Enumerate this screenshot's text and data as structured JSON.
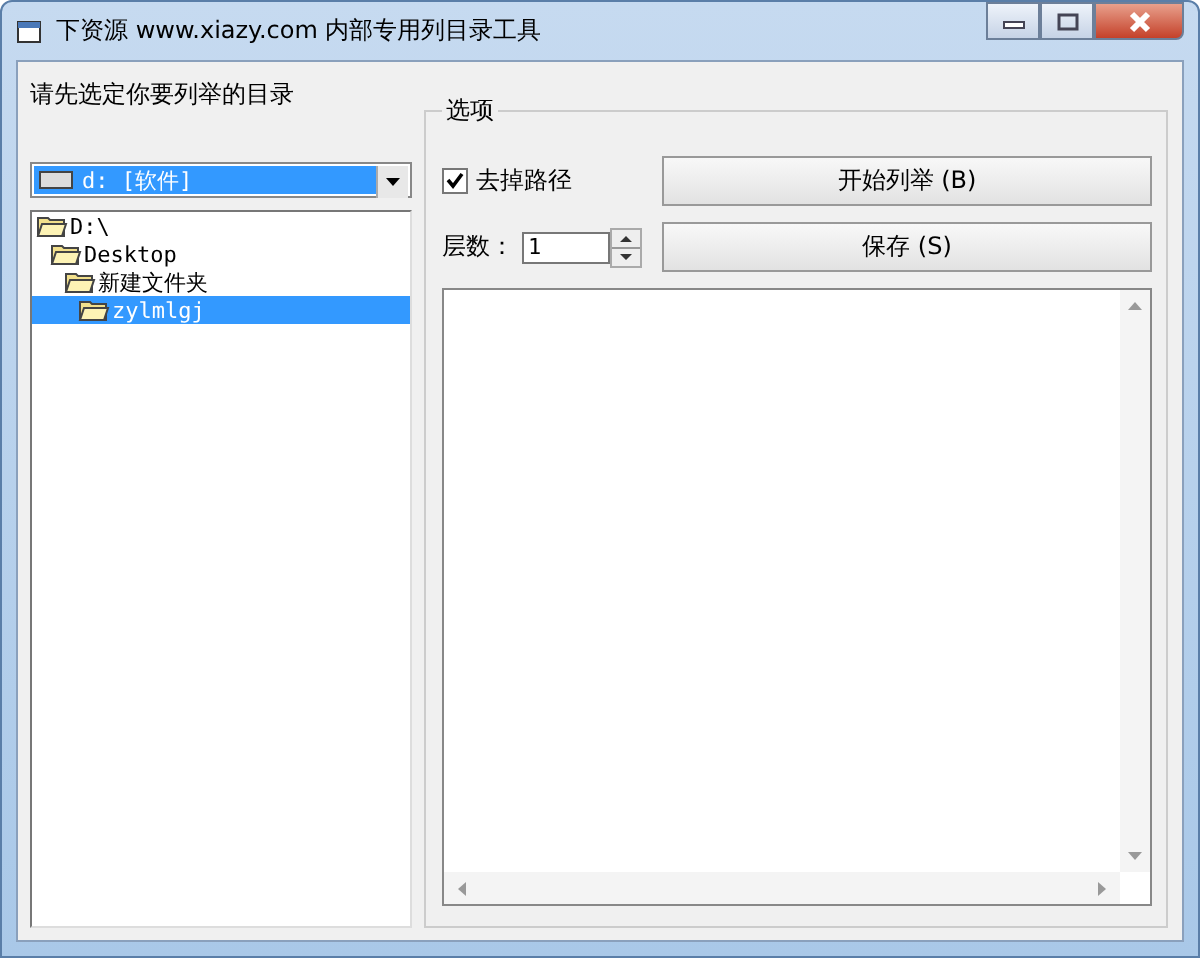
{
  "window": {
    "title": "下资源 www.xiazy.com 内部专用列目录工具"
  },
  "prompt": "请先选定你要列举的目录",
  "drive": {
    "value": "d: [软件]"
  },
  "tree": [
    {
      "label": "D:\\",
      "selected": false,
      "children": [
        {
          "label": "Desktop",
          "selected": false,
          "children": [
            {
              "label": "新建文件夹",
              "selected": false,
              "children": [
                {
                  "label": "zylmlgj",
                  "selected": true
                }
              ]
            }
          ]
        }
      ]
    }
  ],
  "options": {
    "title": "选项",
    "strip_path": {
      "label": "去掉路径",
      "checked": true
    },
    "levels": {
      "label": "层数：",
      "value": "1"
    },
    "buttons": [
      {
        "label": "开始列举 (B)"
      },
      {
        "label": "保存 (S)"
      }
    ]
  }
}
